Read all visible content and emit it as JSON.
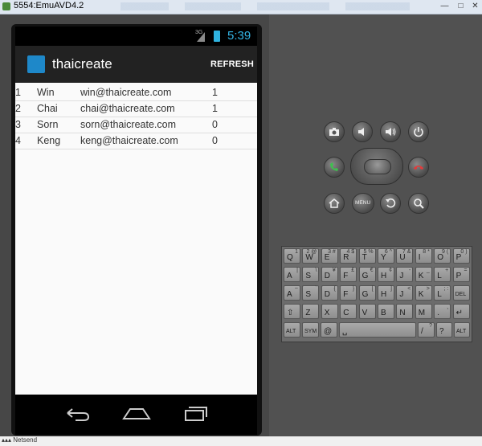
{
  "window": {
    "title": "5554:EmuAVD4.2"
  },
  "bottom_status": "▴▴▴ Netsend",
  "status_bar": {
    "network": "3G",
    "time": "5:39"
  },
  "action_bar": {
    "app_title": "thaicreate",
    "refresh_label": "REFRESH"
  },
  "rows": [
    {
      "id": "1",
      "name": "Win",
      "email": "win@thaicreate.com",
      "count": "1"
    },
    {
      "id": "2",
      "name": "Chai",
      "email": "chai@thaicreate.com",
      "count": "1"
    },
    {
      "id": "3",
      "name": "Sorn",
      "email": "sorn@thaicreate.com",
      "count": "0"
    },
    {
      "id": "4",
      "name": "Keng",
      "email": "keng@thaicreate.com",
      "count": "0"
    }
  ],
  "controls": {
    "volume_down": "volume-down-icon",
    "volume_up": "volume-up-icon",
    "menu_label": "MENU"
  },
  "keyboard": {
    "row1": [
      {
        "m": "Q",
        "a": "1"
      },
      {
        "m": "W",
        "a": "2 @"
      },
      {
        "m": "E",
        "a": "3 #"
      },
      {
        "m": "R",
        "a": "4 $"
      },
      {
        "m": "T",
        "a": "5 %"
      },
      {
        "m": "Y",
        "a": "6 ^"
      },
      {
        "m": "U",
        "a": "7 &"
      },
      {
        "m": "I",
        "a": "8 *"
      },
      {
        "m": "O",
        "a": "9 ("
      },
      {
        "m": "P",
        "a": "0 )"
      }
    ],
    "row2": [
      {
        "m": "A",
        "a": "~"
      },
      {
        "m": "S",
        "a": "`"
      },
      {
        "m": "D",
        "a": "{"
      },
      {
        "m": "F",
        "a": "}"
      },
      {
        "m": "G",
        "a": "["
      },
      {
        "m": "H",
        "a": "]"
      },
      {
        "m": "J",
        "a": "<"
      },
      {
        "m": "K",
        "a": ">"
      },
      {
        "m": "L",
        "a": "; :"
      },
      {
        "m": "DEL",
        "a": ""
      }
    ],
    "row3": [
      {
        "m": "⇧",
        "a": ""
      },
      {
        "m": "Z",
        "a": ""
      },
      {
        "m": "X",
        "a": ""
      },
      {
        "m": "C",
        "a": ""
      },
      {
        "m": "V",
        "a": ""
      },
      {
        "m": "B",
        "a": ""
      },
      {
        "m": "N",
        "a": ""
      },
      {
        "m": "M",
        "a": ""
      },
      {
        "m": ".",
        "a": ","
      },
      {
        "m": "↵",
        "a": ""
      }
    ],
    "row0_top": [
      {
        "m": "A",
        "a": "|"
      },
      {
        "m": "S",
        "a": "\\"
      },
      {
        "m": "D",
        "a": "¥"
      },
      {
        "m": "F",
        "a": "£"
      },
      {
        "m": "G",
        "a": "€"
      },
      {
        "m": "H",
        "a": "¢"
      },
      {
        "m": "J",
        "a": "-"
      },
      {
        "m": "K",
        "a": "_"
      },
      {
        "m": "L",
        "a": "+"
      },
      {
        "m": "P",
        "a": "="
      }
    ],
    "alt_label": "ALT",
    "sym_label": "SYM",
    "at_label": "@",
    "slash_label": "/",
    "question_label": "?"
  }
}
